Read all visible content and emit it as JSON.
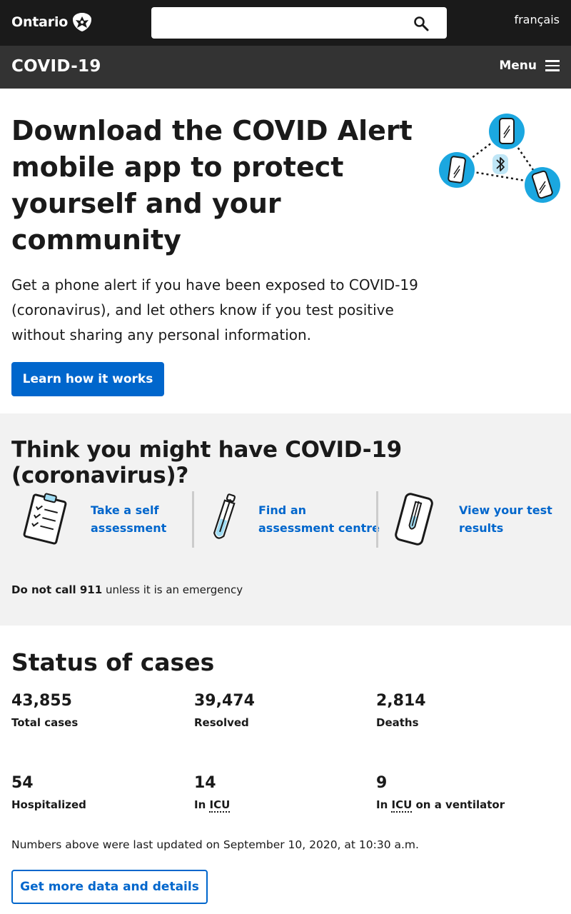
{
  "header": {
    "logo_text": "Ontario",
    "search": {
      "value": "",
      "placeholder": ""
    },
    "language_link": "français"
  },
  "subnav": {
    "title": "COVID-19",
    "menu_label": "Menu"
  },
  "hero": {
    "title": "Download the COVID Alert mobile app to protect yourself and your community",
    "text": "Get a phone alert if you have been exposed to COVID-19 (coronavirus), and let others know if you test positive without sharing any personal information.",
    "button_label": "Learn how it works"
  },
  "symptoms": {
    "title": "Think you might have COVID-19 (coronavirus)?",
    "actions": [
      {
        "label_line1": "Take a self",
        "label_line2": "assessment",
        "icon": "clipboard-icon"
      },
      {
        "label_line1": "Find an",
        "label_line2": "assessment centre",
        "icon": "test-tube-icon"
      },
      {
        "label_line1": "View your test",
        "label_line2": "results",
        "icon": "phone-test-icon"
      }
    ],
    "emergency_bold": "Do not call 911",
    "emergency_rest": " unless it is an emergency"
  },
  "status": {
    "title": "Status of cases",
    "stats": [
      {
        "value": "43,855",
        "label": "Total cases"
      },
      {
        "value": "39,474",
        "label": "Resolved"
      },
      {
        "value": "2,814",
        "label": "Deaths"
      },
      {
        "value": "54",
        "label": "Hospitalized"
      },
      {
        "value": "14",
        "label_pre": "In ",
        "label_abbr": "ICU",
        "label_post": ""
      },
      {
        "value": "9",
        "label_pre": "In ",
        "label_abbr": "ICU",
        "label_post": " on a ventilator"
      }
    ],
    "updated_text": "Numbers above were last updated on September 10, 2020, at 10:30 a.m.",
    "more_button": "Get more data and details"
  },
  "colors": {
    "topbar": "#1a1a1a",
    "subnav": "#333333",
    "primary": "#0066cc",
    "grey_bg": "#f2f2f2",
    "illustration_blue": "#1ba7e0"
  }
}
